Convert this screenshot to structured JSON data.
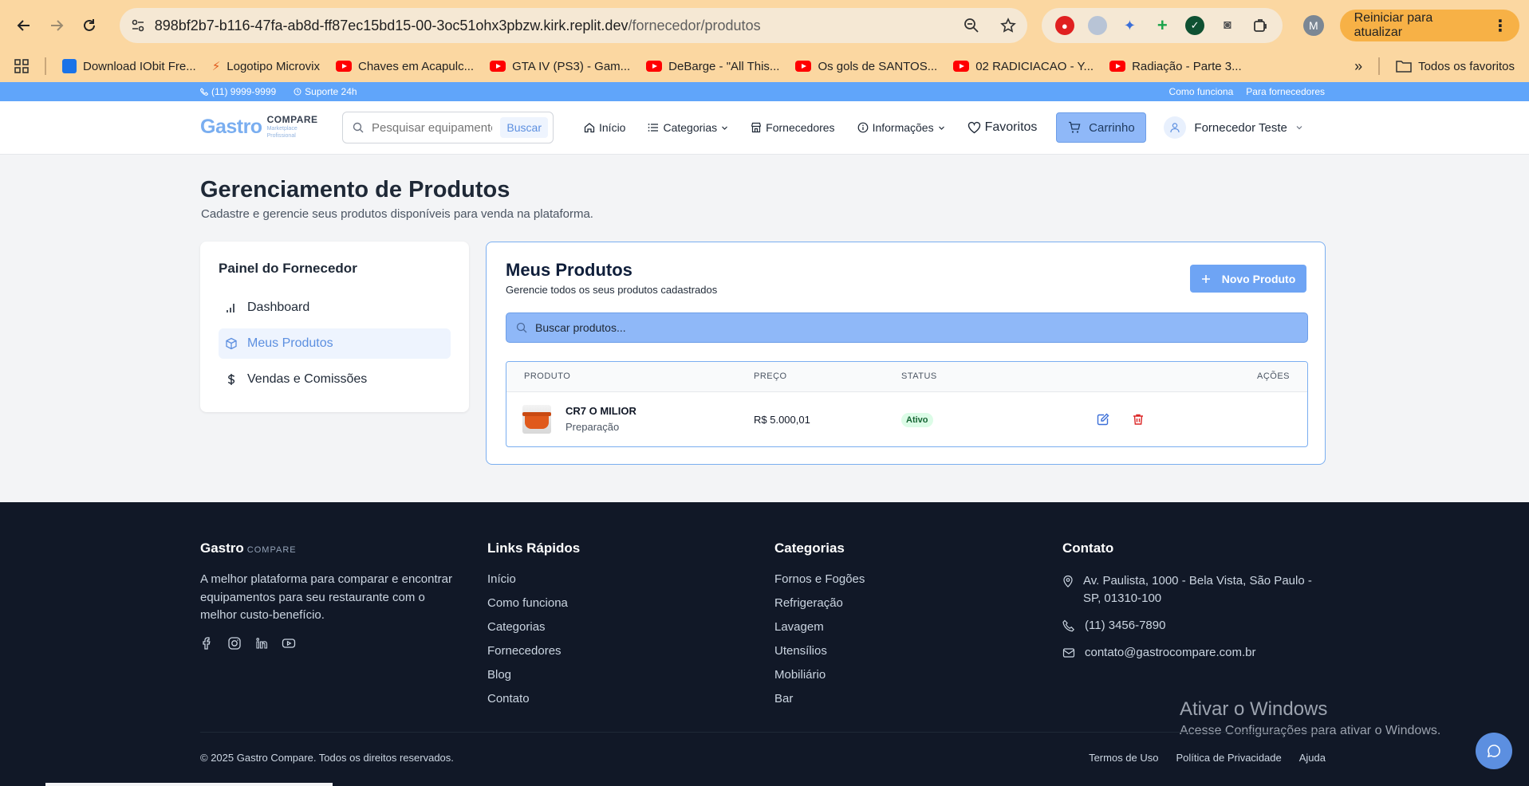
{
  "browser": {
    "url_host": "898bf2b7-b116-47fa-ab8d-ff87ec15bd15-00-3oc51ohx3pbzw.kirk.replit.dev",
    "url_path": "/fornecedor/produtos",
    "profile_initial": "M",
    "update_label": "Reiniciar para atualizar",
    "bookmarks": [
      {
        "label": "Download IObit Fre...",
        "icon": "iobit-icon"
      },
      {
        "label": "Logotipo Microvix",
        "icon": "microvix-icon"
      },
      {
        "label": "Chaves em Acapulc...",
        "icon": "youtube-icon"
      },
      {
        "label": "GTA IV (PS3) - Gam...",
        "icon": "youtube-icon"
      },
      {
        "label": "DeBarge - \"All This...",
        "icon": "youtube-icon"
      },
      {
        "label": "Os gols de SANTOS...",
        "icon": "youtube-icon"
      },
      {
        "label": "02 RADICIACAO - Y...",
        "icon": "youtube-icon"
      },
      {
        "label": "Radiação - Parte 3...",
        "icon": "youtube-icon"
      }
    ],
    "all_bookmarks_label": "Todos os favoritos"
  },
  "topbar": {
    "phone": "(11) 9999-9999",
    "support": "Suporte 24h",
    "how_it_works": "Como funciona",
    "for_suppliers": "Para fornecedores"
  },
  "header": {
    "logo_main": "Gastro",
    "logo_compare": "COMPARE",
    "logo_sub1": "Marketplace",
    "logo_sub2": "Profissional",
    "search_placeholder": "Pesquisar equipamentos...",
    "search_button": "Buscar",
    "nav": {
      "home": "Início",
      "categories": "Categorias",
      "suppliers": "Fornecedores",
      "info": "Informações",
      "favorites": "Favoritos",
      "cart": "Carrinho",
      "user": "Fornecedor Teste"
    }
  },
  "page": {
    "title": "Gerenciamento de Produtos",
    "subtitle": "Cadastre e gerencie seus produtos disponíveis para venda na plataforma."
  },
  "sidebar": {
    "title": "Painel do Fornecedor",
    "items": [
      {
        "label": "Dashboard",
        "icon": "bar-chart-icon",
        "active": false
      },
      {
        "label": "Meus Produtos",
        "icon": "package-icon",
        "active": true
      },
      {
        "label": "Vendas e Comissões",
        "icon": "dollar-icon",
        "active": false
      }
    ]
  },
  "products": {
    "title": "Meus Produtos",
    "subtitle": "Gerencie todos os seus produtos cadastrados",
    "new_button": "Novo Produto",
    "search_placeholder": "Buscar produtos...",
    "columns": {
      "product": "PRODUTO",
      "price": "PREÇO",
      "status": "STATUS",
      "actions": "AÇÕES"
    },
    "rows": [
      {
        "name": "CR7 O MILIOR",
        "category": "Preparação",
        "price": "R$ 5.000,01",
        "status": "Ativo"
      }
    ]
  },
  "footer": {
    "logo_main": "Gastro",
    "logo_compare": "COMPARE",
    "description": "A melhor plataforma para comparar e encontrar equipamentos para seu restaurante com o melhor custo-benefício.",
    "quick_links_title": "Links Rápidos",
    "quick_links": [
      "Início",
      "Como funciona",
      "Categorias",
      "Fornecedores",
      "Blog",
      "Contato"
    ],
    "categories_title": "Categorias",
    "categories": [
      "Fornos e Fogões",
      "Refrigeração",
      "Lavagem",
      "Utensílios",
      "Mobiliário",
      "Bar"
    ],
    "contact_title": "Contato",
    "address": "Av. Paulista, 1000 - Bela Vista, São Paulo - SP, 01310-100",
    "phone": "(11) 3456-7890",
    "email": "contato@gastrocompare.com.br",
    "copyright": "© 2025 Gastro Compare. Todos os direitos reservados.",
    "bottom_links": [
      "Termos de Uso",
      "Política de Privacidade",
      "Ajuda"
    ]
  },
  "windows_watermark": {
    "line1": "Ativar o Windows",
    "line2": "Acesse Configurações para ativar o Windows."
  },
  "colors": {
    "accent": "#60a5fa",
    "primary_button": "#6ea4f4",
    "footer_bg": "#111827",
    "status_active_bg": "#dcfce7",
    "delete_red": "#dc2626"
  }
}
